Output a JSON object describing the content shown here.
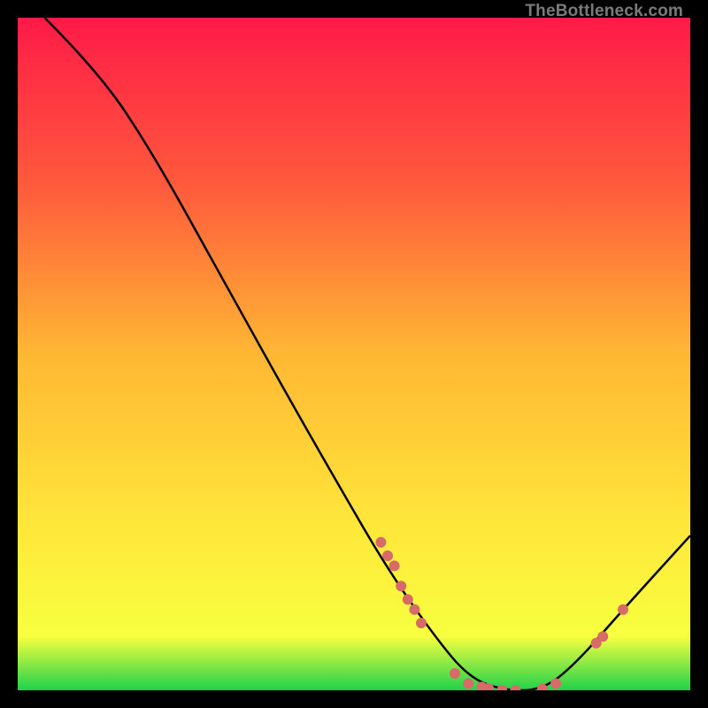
{
  "watermark": "TheBottleneck.com",
  "chart_data": {
    "type": "line",
    "title": "",
    "xlabel": "",
    "ylabel": "",
    "xlim": [
      0,
      100
    ],
    "ylim": [
      0,
      100
    ],
    "grid": false,
    "legend": false,
    "gradient_stops": [
      {
        "offset": 0.0,
        "color": "#ff1a47"
      },
      {
        "offset": 0.25,
        "color": "#ff5a3c"
      },
      {
        "offset": 0.5,
        "color": "#ffb733"
      },
      {
        "offset": 0.75,
        "color": "#ffe63a"
      },
      {
        "offset": 0.92,
        "color": "#f7ff3f"
      },
      {
        "offset": 1.0,
        "color": "#1fd24a"
      }
    ],
    "series": [
      {
        "name": "bottleneck-curve",
        "color": "#000000",
        "points": [
          {
            "x": 4,
            "y": 100
          },
          {
            "x": 12,
            "y": 92
          },
          {
            "x": 20,
            "y": 80
          },
          {
            "x": 30,
            "y": 62
          },
          {
            "x": 40,
            "y": 44
          },
          {
            "x": 48,
            "y": 30
          },
          {
            "x": 55,
            "y": 18
          },
          {
            "x": 62,
            "y": 8
          },
          {
            "x": 67,
            "y": 2
          },
          {
            "x": 72,
            "y": 0
          },
          {
            "x": 78,
            "y": 0
          },
          {
            "x": 83,
            "y": 4
          },
          {
            "x": 90,
            "y": 12
          },
          {
            "x": 100,
            "y": 23
          }
        ]
      }
    ],
    "markers": {
      "color": "#d86a6a",
      "radius": 6,
      "points": [
        {
          "x": 54,
          "y": 22
        },
        {
          "x": 55,
          "y": 20
        },
        {
          "x": 56,
          "y": 18.5
        },
        {
          "x": 57,
          "y": 15.5
        },
        {
          "x": 58,
          "y": 13.5
        },
        {
          "x": 59,
          "y": 12
        },
        {
          "x": 60,
          "y": 10
        },
        {
          "x": 65,
          "y": 2.5
        },
        {
          "x": 67,
          "y": 1
        },
        {
          "x": 69,
          "y": 0.5
        },
        {
          "x": 70,
          "y": 0.3
        },
        {
          "x": 72,
          "y": 0
        },
        {
          "x": 74,
          "y": 0
        },
        {
          "x": 78,
          "y": 0.2
        },
        {
          "x": 80,
          "y": 1
        },
        {
          "x": 86,
          "y": 7
        },
        {
          "x": 87,
          "y": 8
        },
        {
          "x": 90,
          "y": 12
        }
      ]
    }
  }
}
